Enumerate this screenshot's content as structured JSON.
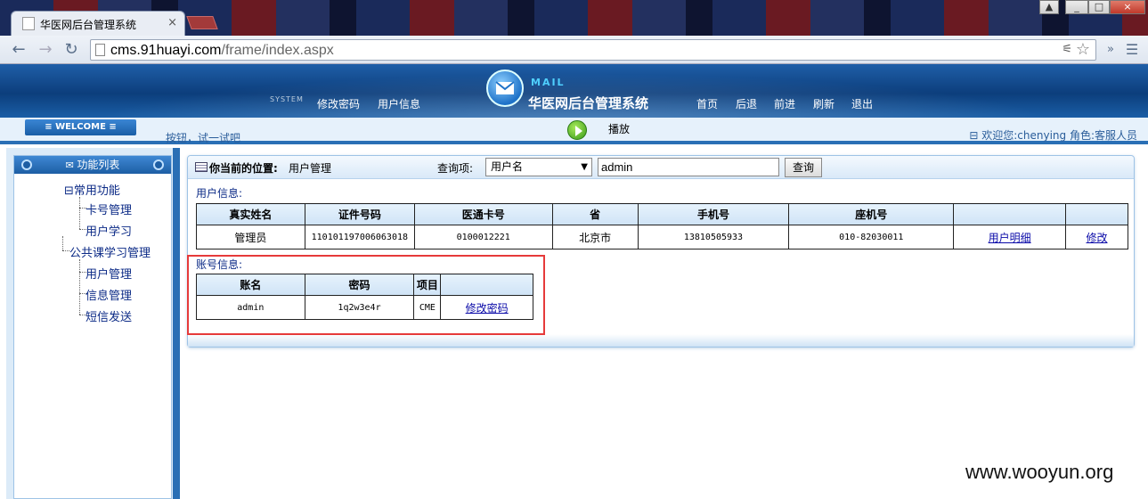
{
  "browser": {
    "tab_title": "华医网后台管理系统",
    "tab_close": "×",
    "url_host": "cms.91huayi.com",
    "url_path": "/frame/index.aspx",
    "win_controls": [
      "▲",
      "_",
      "□",
      "×"
    ]
  },
  "header": {
    "system_tag": "SYSTEM",
    "left_links": [
      "修改密码",
      "用户信息"
    ],
    "mail_label": "MAIL",
    "site_title": "华医网后台管理系统",
    "right_links": [
      "首页",
      "后退",
      "前进",
      "刷新",
      "退出"
    ]
  },
  "welcome": {
    "tab_label": "≡ WELCOME ≡",
    "hint": "按钮，试一试吧",
    "play_label": "播放",
    "user_text": "欢迎您:chenying 角色:客服人员"
  },
  "sidebar": {
    "header": "功能列表",
    "groups": [
      {
        "label": "⊟常用功能",
        "items": [
          "卡号管理",
          "用户学习"
        ]
      },
      {
        "label": "公共课学习管理",
        "items": [
          "用户管理",
          "信息管理",
          "短信发送"
        ]
      }
    ]
  },
  "main": {
    "position_label": "你当前的位置:",
    "position_value": "用户管理",
    "query_label": "查询项:",
    "query_select": "用户名",
    "query_value": "admin",
    "query_button": "查询",
    "user_section": "用户信息:",
    "user_table": {
      "headers": [
        "真实姓名",
        "证件号码",
        "医通卡号",
        "省",
        "手机号",
        "座机号",
        "",
        ""
      ],
      "row": [
        "管理员",
        "110101197006063018",
        "0100012221",
        "北京市",
        "13810505933",
        "010-82030011",
        "用户明细",
        "修改"
      ]
    },
    "account_section": "账号信息:",
    "account_table": {
      "headers": [
        "账名",
        "密码",
        "项目",
        ""
      ],
      "row": [
        "admin",
        "1q2w3e4r",
        "CME",
        "修改密码"
      ]
    }
  },
  "watermark": "www.wooyun.org"
}
